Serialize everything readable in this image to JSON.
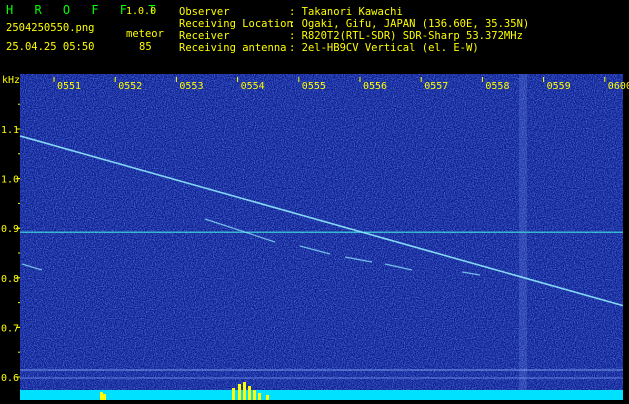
{
  "header": {
    "app_title": "H R O F F T",
    "version": "1.0.0",
    "filename": "2504250550.png",
    "timestamp": "25.04.25 05:50",
    "mode_label": "meteor",
    "mode_count": "85",
    "fields": [
      {
        "key": "Observer",
        "value": ": Takanori Kawachi"
      },
      {
        "key": "Receiving Location",
        "value": ": Ogaki, Gifu, JAPAN (136.60E, 35.35N)"
      },
      {
        "key": "Receiver",
        "value": ": R820T2(RTL-SDR) SDR-Sharp 53.372MHz"
      },
      {
        "key": "Receiving antenna",
        "value": ": 2el-HB9CV Vertical (el. E-W)"
      }
    ]
  },
  "spectrogram": {
    "unit_label": "kHz",
    "time_ticks": [
      "0551",
      "0552",
      "0553",
      "0554",
      "0555",
      "0556",
      "0557",
      "0558",
      "0559",
      "0600"
    ],
    "freq_ticks": [
      1.1,
      1.0,
      0.9,
      0.8,
      0.7,
      0.6
    ],
    "freq_range": [
      0.62,
      1.18
    ],
    "reference_line_khz": 0.892,
    "colors": {
      "background": "#0a1a8a",
      "text": "#ffff00",
      "reference_line": "#40e0e0",
      "trace": "#8fe8ff",
      "bottom_bar": "#00e0ff",
      "spike": "#ffff00"
    }
  }
}
